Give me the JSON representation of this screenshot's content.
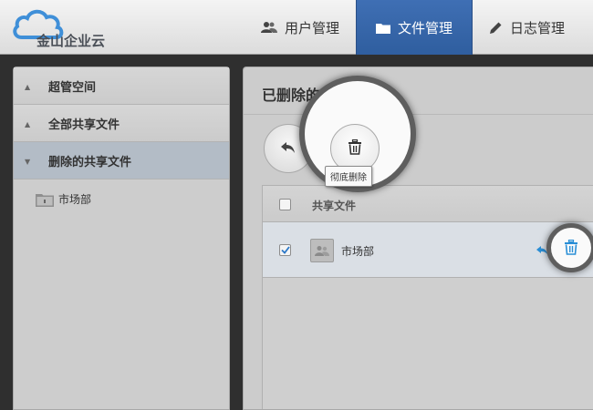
{
  "app": {
    "logo_text": "金山企业云"
  },
  "nav": {
    "items": [
      {
        "label": "用户管理",
        "icon": "users-icon"
      },
      {
        "label": "文件管理",
        "icon": "folder-icon",
        "active": true
      },
      {
        "label": "日志管理",
        "icon": "pencil-icon"
      }
    ]
  },
  "sidebar": {
    "items": [
      {
        "label": "超管空间",
        "expanded": false
      },
      {
        "label": "全部共享文件",
        "expanded": false
      },
      {
        "label": "删除的共享文件",
        "expanded": true
      }
    ],
    "tree": [
      {
        "label": "市场部",
        "icon": "folder-icon"
      }
    ]
  },
  "main": {
    "title": "已删除的共享文件",
    "toolbar": {
      "restore_icon": "restore-icon",
      "delete_icon": "trash-icon",
      "delete_tooltip": "彻底删除"
    },
    "table": {
      "header": {
        "name_label": "共享文件"
      },
      "rows": [
        {
          "name": "市场部",
          "checked": true,
          "icon": "shared-folder-icon"
        }
      ]
    }
  },
  "colors": {
    "nav_active": "#3a68ad",
    "accent_blue": "#2b8fd6",
    "sidebar_active": "#b3bcc6"
  }
}
